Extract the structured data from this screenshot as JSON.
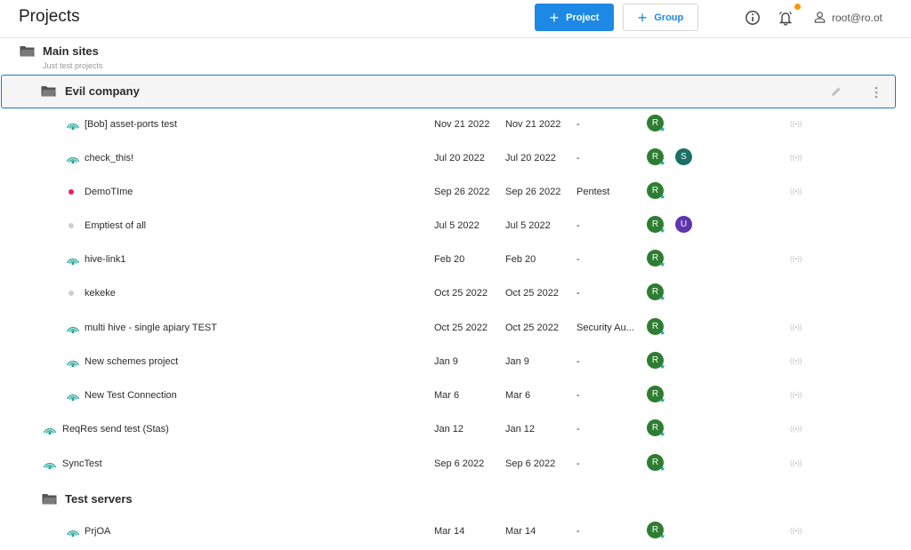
{
  "header": {
    "title": "Projects",
    "project_button": "Project",
    "group_button": "Group",
    "user": "root@ro.ot",
    "accent": "#1e88e5",
    "notification_dot": "#ff9800"
  },
  "groups": {
    "main": {
      "title": "Main sites",
      "description": "Just test projects"
    },
    "evil": {
      "title": "Evil company"
    },
    "test": {
      "title": "Test servers"
    }
  },
  "rows": [
    {
      "name": "[Bob] asset-ports test",
      "c1": "Nov 21 2022",
      "c2": "Nov 21 2022",
      "c3": "-",
      "icon": "hive-icon",
      "avatars": [
        "R"
      ],
      "signal": true
    },
    {
      "name": "check_this!",
      "c1": "Jul 20 2022",
      "c2": "Jul 20 2022",
      "c3": "-",
      "icon": "hive-icon",
      "avatars": [
        "R",
        "S"
      ],
      "signal": true
    },
    {
      "name": "DemoTIme",
      "c1": "Sep 26 2022",
      "c2": "Sep 26 2022",
      "c3": "Pentest",
      "icon": "dot-red",
      "avatars": [
        "R"
      ],
      "signal": true
    },
    {
      "name": "Emptiest of all",
      "c1": "Jul 5 2022",
      "c2": "Jul 5 2022",
      "c3": "-",
      "icon": "dot-gray",
      "avatars": [
        "R",
        "U"
      ],
      "signal": false
    },
    {
      "name": "hive-link1",
      "c1": "Feb 20",
      "c2": "Feb 20",
      "c3": "-",
      "icon": "hive-icon",
      "avatars": [
        "R"
      ],
      "signal": true
    },
    {
      "name": "kekeke",
      "c1": "Oct 25 2022",
      "c2": "Oct 25 2022",
      "c3": "-",
      "icon": "dot-gray",
      "avatars": [
        "R"
      ],
      "signal": false
    },
    {
      "name": "multi hive - single apiary TEST",
      "c1": "Oct 25 2022",
      "c2": "Oct 25 2022",
      "c3": "Security Au...",
      "icon": "hive-icon",
      "avatars": [
        "R"
      ],
      "signal": true
    },
    {
      "name": "New schemes project",
      "c1": "Jan 9",
      "c2": "Jan 9",
      "c3": "-",
      "icon": "hive-icon",
      "avatars": [
        "R"
      ],
      "signal": true
    },
    {
      "name": "New Test Connection",
      "c1": "Mar 6",
      "c2": "Mar 6",
      "c3": "-",
      "icon": "hive-icon",
      "avatars": [
        "R"
      ],
      "signal": true
    },
    {
      "name": "ReqRes send test (Stas)",
      "c1": "Jan 12",
      "c2": "Jan 12",
      "c3": "-",
      "icon": "hive-icon",
      "avatars": [
        "R"
      ],
      "signal": true
    },
    {
      "name": "SyncTest",
      "c1": "Sep 6 2022",
      "c2": "Sep 6 2022",
      "c3": "-",
      "icon": "hive-icon",
      "avatars": [
        "R"
      ],
      "signal": true
    },
    {
      "name": "PrjOA",
      "c1": "Mar 14",
      "c2": "Mar 14",
      "c3": "-",
      "icon": "hive-icon",
      "avatars": [
        "R"
      ],
      "signal": true
    }
  ],
  "signal_glyph": "((•))",
  "avatar_colors": {
    "R": "#2e7d32",
    "S": "#1b6f65",
    "U": "#5e35b1"
  }
}
